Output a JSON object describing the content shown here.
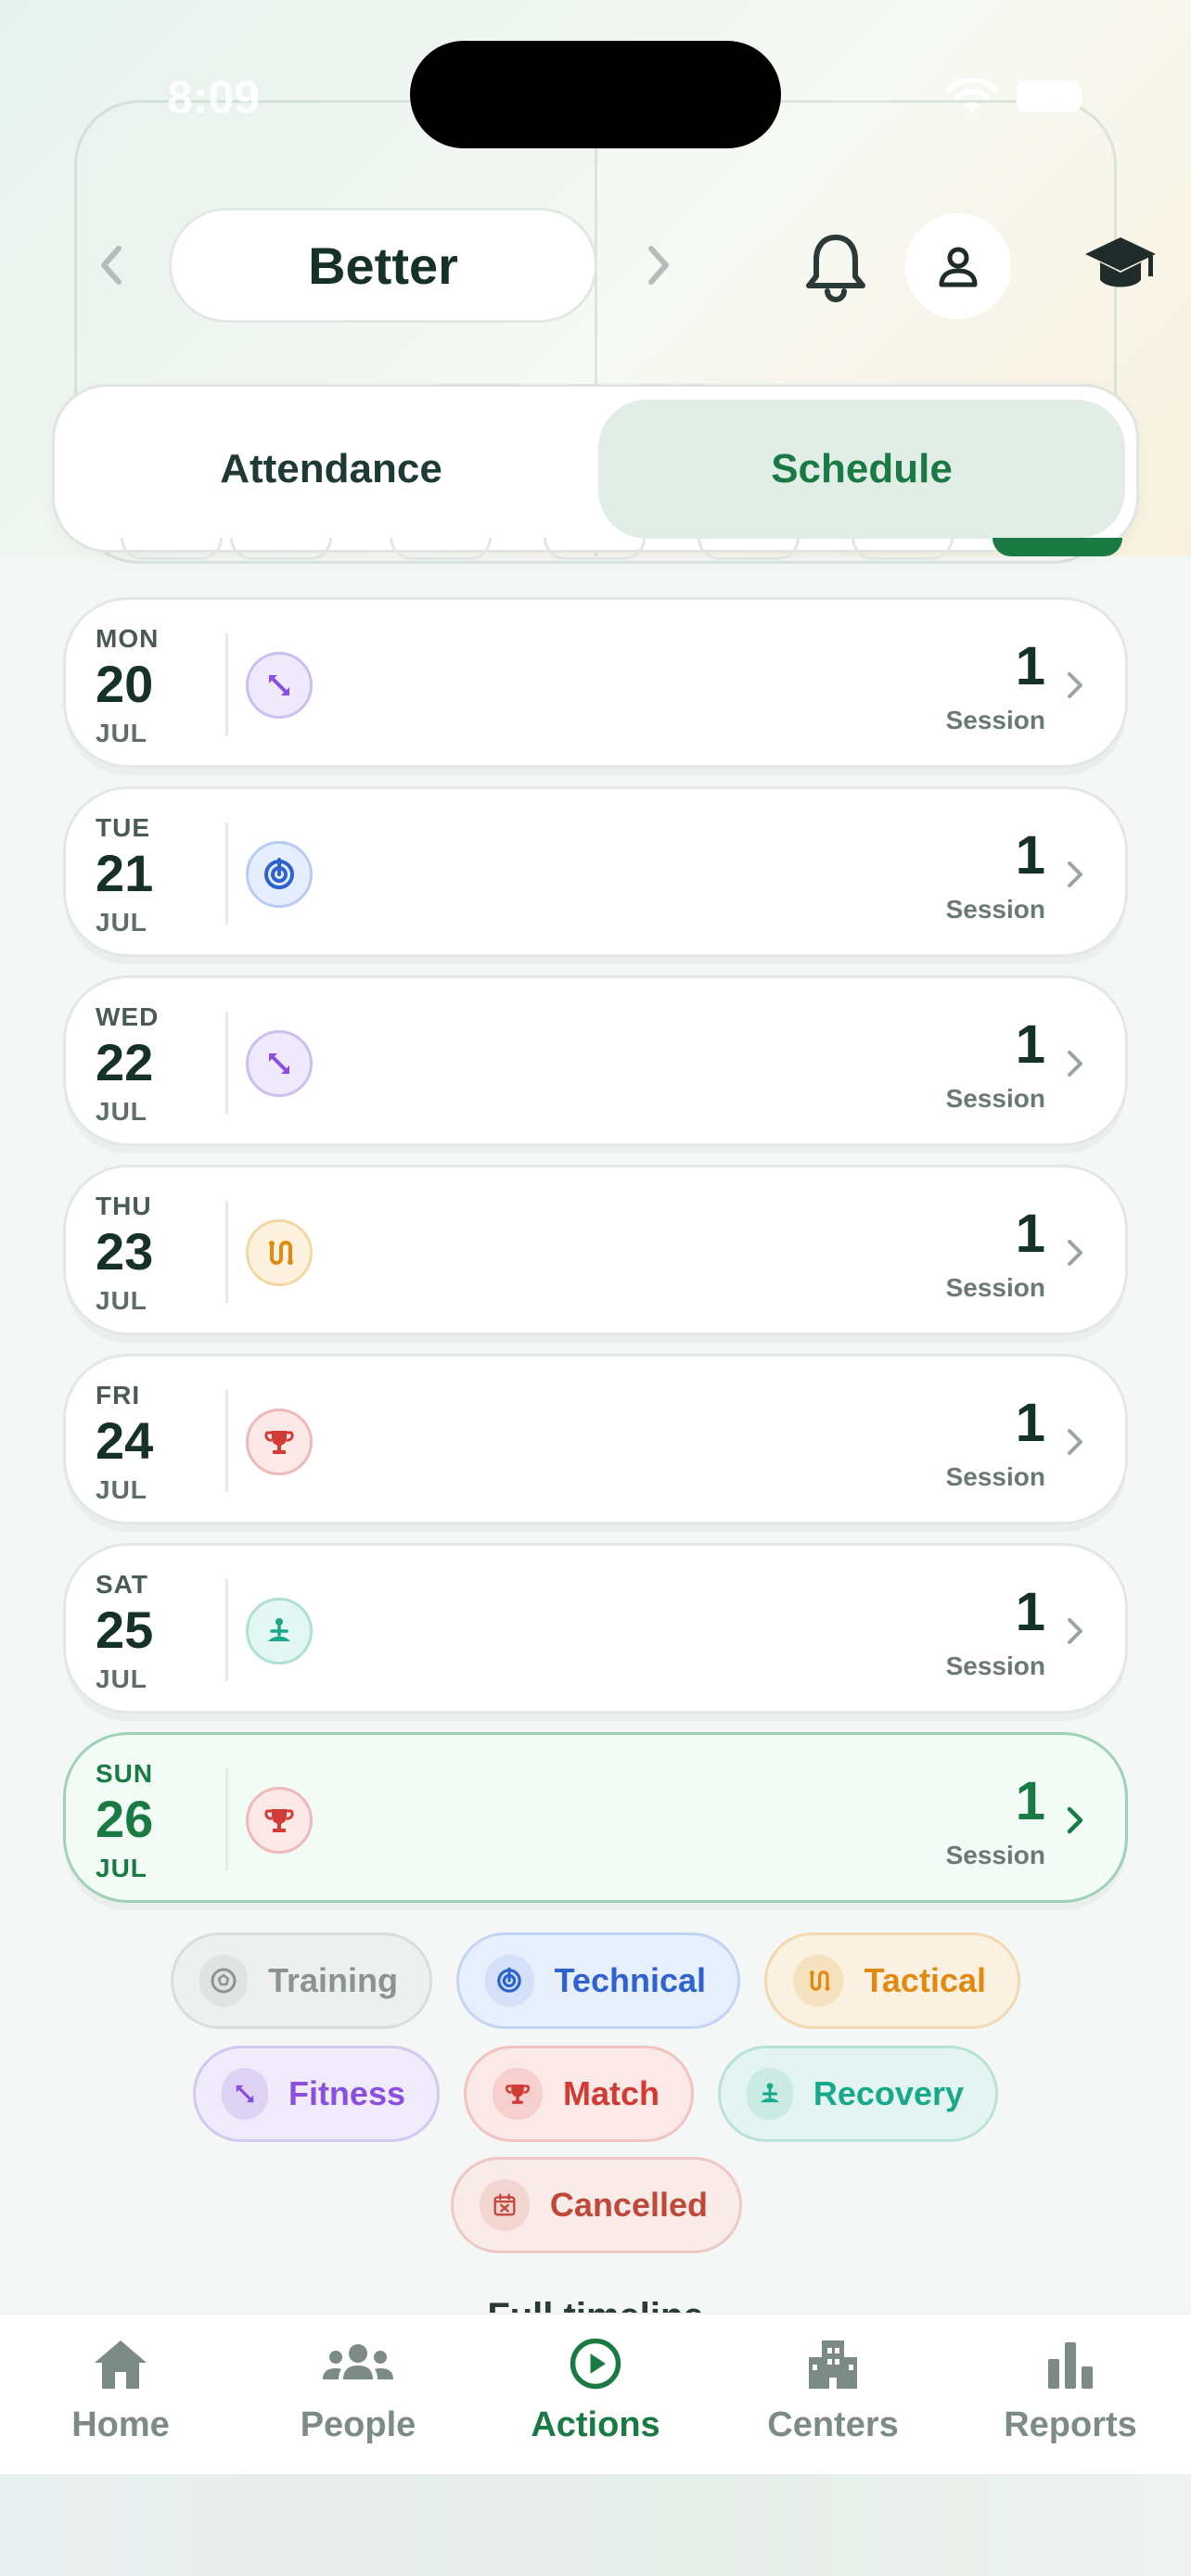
{
  "status_bar": {
    "time": "8:09"
  },
  "header": {
    "title": "Better",
    "prev_icon": "chevron-left-icon",
    "next_icon": "chevron-right-icon",
    "notification_icon": "bell-icon",
    "profile_icon": "person-icon",
    "academy_icon": "graduation-cap-icon"
  },
  "segments": {
    "attendance": "Attendance",
    "schedule": "Schedule",
    "selected": "Schedule"
  },
  "days": [
    {
      "abbr": "MON",
      "num": "20",
      "month": "JUL",
      "type": "fitness",
      "count": "1",
      "label": "Session"
    },
    {
      "abbr": "TUE",
      "num": "21",
      "month": "JUL",
      "type": "technical",
      "count": "1",
      "label": "Session"
    },
    {
      "abbr": "WED",
      "num": "22",
      "month": "JUL",
      "type": "fitness",
      "count": "1",
      "label": "Session"
    },
    {
      "abbr": "THU",
      "num": "23",
      "month": "JUL",
      "type": "tactical",
      "count": "1",
      "label": "Session"
    },
    {
      "abbr": "FRI",
      "num": "24",
      "month": "JUL",
      "type": "match",
      "count": "1",
      "label": "Session"
    },
    {
      "abbr": "SAT",
      "num": "25",
      "month": "JUL",
      "type": "recovery",
      "count": "1",
      "label": "Session"
    },
    {
      "abbr": "SUN",
      "num": "26",
      "month": "JUL",
      "type": "match",
      "count": "1",
      "label": "Session",
      "today": true
    }
  ],
  "legend": {
    "training": "Training",
    "technical": "Technical",
    "tactical": "Tactical",
    "fitness": "Fitness",
    "match": "Match",
    "recovery": "Recovery",
    "cancelled": "Cancelled"
  },
  "full_timeline": "Full timeline",
  "tabs": {
    "home": "Home",
    "people": "People",
    "actions": "Actions",
    "centers": "Centers",
    "reports": "Reports",
    "active": "Actions"
  },
  "colors": {
    "accent": "#1a7a44",
    "fitness": "#8a4fe0",
    "technical": "#2e63cf",
    "tactical": "#e08a12",
    "match": "#d23a34",
    "recovery": "#18a88c",
    "training": "#8a9490",
    "cancelled": "#c0483a"
  }
}
